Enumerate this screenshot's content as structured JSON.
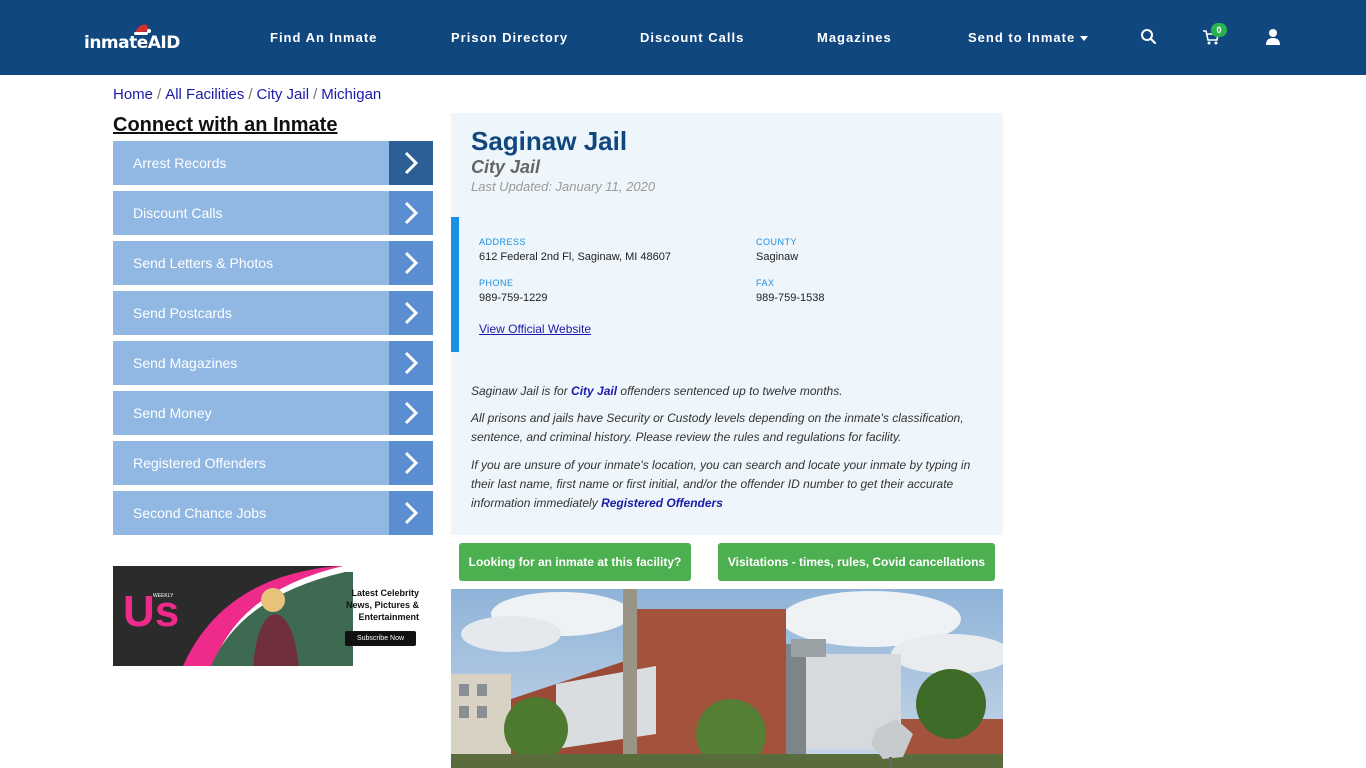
{
  "nav": {
    "logo_text": "inmateAID",
    "items": [
      "Find An Inmate",
      "Prison Directory",
      "Discount Calls",
      "Magazines",
      "Send to Inmate"
    ],
    "cart_count": "0"
  },
  "breadcrumb": [
    "Home",
    "All Facilities",
    "City Jail",
    "Michigan"
  ],
  "sidebar": {
    "title": "Connect with an Inmate",
    "items": [
      {
        "label": "Arrest Records"
      },
      {
        "label": "Discount Calls"
      },
      {
        "label": "Send Letters & Photos"
      },
      {
        "label": "Send Postcards"
      },
      {
        "label": "Send Magazines"
      },
      {
        "label": "Send Money"
      },
      {
        "label": "Registered Offenders"
      },
      {
        "label": "Second Chance Jobs"
      }
    ],
    "ad": {
      "brand": "Us",
      "brand_small": "WEEKLY",
      "line1": "Latest Celebrity",
      "line2": "News, Pictures &",
      "line3": "Entertainment",
      "cta": "Subscribe Now"
    }
  },
  "facility": {
    "name": "Saginaw Jail",
    "type": "City Jail",
    "last_updated": "Last Updated: January 11, 2020",
    "address_label": "ADDRESS",
    "address": "612 Federal 2nd Fl, Saginaw, MI 48607",
    "county_label": "COUNTY",
    "county": "Saginaw",
    "phone_label": "PHONE",
    "phone": "989-759-1229",
    "fax_label": "FAX",
    "fax": "989-759-1538",
    "website_link": "View Official Website"
  },
  "description": {
    "p1_prefix": "Saginaw Jail is for ",
    "p1_link": "City Jail",
    "p1_suffix": " offenders sentenced up to twelve months.",
    "p2": "All prisons and jails have Security or Custody levels depending on the inmate's classification, sentence, and criminal history. Please review the rules and regulations for facility.",
    "p3_prefix": "If you are unsure of your inmate's location, you can search and locate your inmate by typing in their last name, first name or first initial, and/or the offender ID number to get their accurate information immediately ",
    "p3_link": "Registered Offenders"
  },
  "buttons": {
    "find_inmate": "Looking for an inmate at this facility?",
    "visitations": "Visitations - times, rules, Covid cancellations"
  },
  "colors": {
    "navbar": "#10477f",
    "side_button": "#90b8e3",
    "side_arrow": "#5b8ed0",
    "green": "#4caf50",
    "accent_blue": "#1a8fe6"
  }
}
